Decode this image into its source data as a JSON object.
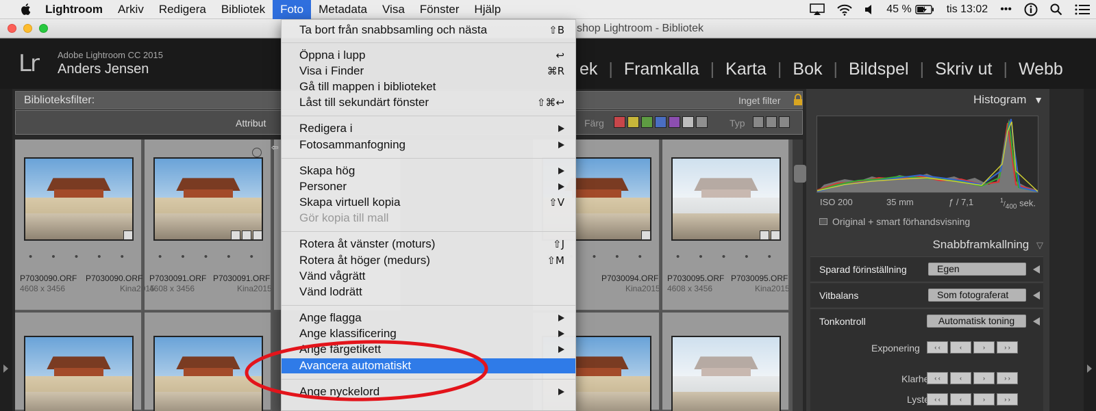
{
  "menubar": {
    "app": "Lightroom",
    "items": [
      "Arkiv",
      "Redigera",
      "Bibliotek",
      "Foto",
      "Metadata",
      "Visa",
      "Fönster",
      "Hjälp"
    ],
    "active": "Foto",
    "battery": "45 %",
    "time": "tis 13:02",
    "more": "•••"
  },
  "window": {
    "title": "shop Lightroom - Bibliotek"
  },
  "lrheader": {
    "logo": "Lr",
    "product": "Adobe Lightroom CC 2015",
    "user": "Anders Jensen",
    "modules": [
      "ek",
      "Framkalla",
      "Karta",
      "Bok",
      "Bildspel",
      "Skriv ut",
      "Webb"
    ]
  },
  "filter": {
    "title": "Biblioteksfilter:",
    "preset": "Inget filter",
    "attribute_label": "Attribut",
    "color_label": "Färg",
    "type_label": "Typ",
    "swatches": [
      "#c8464a",
      "#c7b63a",
      "#5e9c42",
      "#4a6ec2",
      "#8c4eb1",
      "#bdbdbd",
      "#8f8f8f"
    ]
  },
  "grid": {
    "cells": [
      {
        "left_name": "P7030090.ORF",
        "right_name": "P7030090.ORF",
        "size": "4608 x 3456",
        "collection": "",
        "variant": "blue"
      },
      {
        "left_name": "P7030091.ORF",
        "right_name": "P7030091.ORF",
        "size": "4608 x 3456",
        "collection": "Kina2015",
        "variant": "blue"
      },
      {
        "left_name": "",
        "right_name": "P7030094.ORF",
        "size": "",
        "collection": "Kina2015",
        "variant": "blue"
      },
      {
        "left_name": "P7030095.ORF",
        "right_name": "P7030095.ORF",
        "size": "4608 x 3456",
        "collection": "Kina2015",
        "variant": "white"
      }
    ],
    "first_collection": "Kina2015",
    "dots": "• • • • •"
  },
  "rpanel": {
    "histogram_title": "Histogram",
    "iso": "ISO 200",
    "focal": "35 mm",
    "aperture": "ƒ / 7,1",
    "shutter_num": "1",
    "shutter_den": "400",
    "shutter_unit": "sek.",
    "preview": "Original + smart förhandsvisning",
    "quick_title": "Snabbframkallning",
    "preset_label": "Sparad förinställning",
    "preset_value": "Egen",
    "wb_label": "Vitbalans",
    "wb_value": "Som fotograferat",
    "tone_label": "Tonkontroll",
    "tone_button": "Automatisk toning",
    "exposure_label": "Exponering",
    "clarity_label": "Klarhet",
    "vibrance_label": "Lyster",
    "step_buttons": [
      "‹ ‹",
      "‹",
      "›",
      "› ›"
    ]
  },
  "menu": {
    "items": [
      {
        "label": "Ta bort från snabbsamling och nästa",
        "shortcut": "⇧B"
      },
      {
        "label": "Öppna i lupp",
        "shortcut": "↩"
      },
      {
        "label": "Visa i Finder",
        "shortcut": "⌘R"
      },
      {
        "label": "Gå till mappen i biblioteket",
        "shortcut": ""
      },
      {
        "label": "Låst till sekundärt fönster",
        "shortcut": "⇧⌘↩"
      },
      {
        "label": "Redigera i",
        "shortcut": ""
      },
      {
        "label": "Fotosammanfogning",
        "shortcut": ""
      },
      {
        "label": "Skapa hög",
        "shortcut": ""
      },
      {
        "label": "Personer",
        "shortcut": ""
      },
      {
        "label": "Skapa virtuell kopia",
        "shortcut": "⇧V"
      },
      {
        "label": "Gör kopia till mall",
        "shortcut": ""
      },
      {
        "label": "Rotera åt vänster (moturs)",
        "shortcut": "⇧J"
      },
      {
        "label": "Rotera åt höger (medurs)",
        "shortcut": "⇧M"
      },
      {
        "label": "Vänd vågrätt",
        "shortcut": ""
      },
      {
        "label": "Vänd lodrätt",
        "shortcut": ""
      },
      {
        "label": "Ange flagga",
        "shortcut": ""
      },
      {
        "label": "Ange klassificering",
        "shortcut": ""
      },
      {
        "label": "Ange färgetikett",
        "shortcut": ""
      },
      {
        "label": "Avancera automatiskt",
        "shortcut": ""
      },
      {
        "label": "Ange nyckelord",
        "shortcut": ""
      }
    ]
  }
}
